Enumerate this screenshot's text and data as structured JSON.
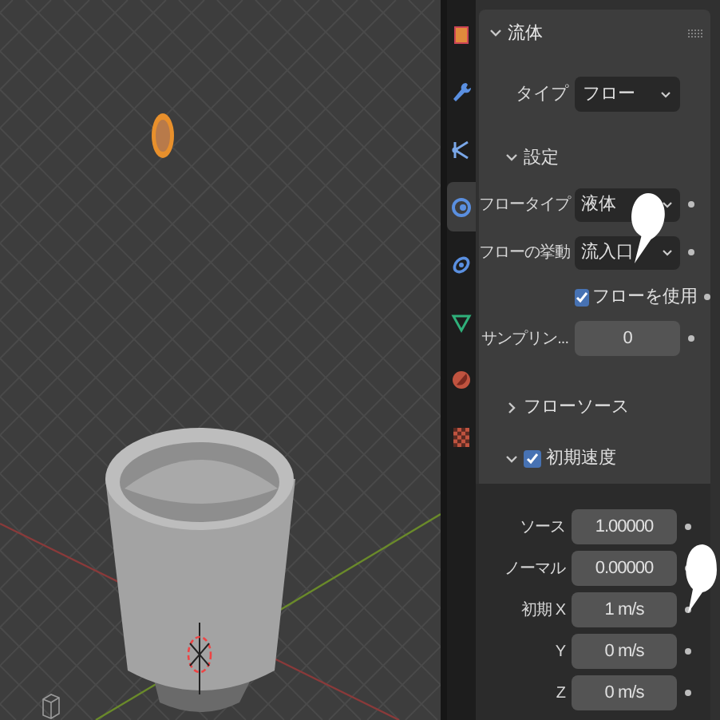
{
  "tabs": [
    {
      "kind": "object",
      "selected": false
    },
    {
      "kind": "modifier",
      "selected": false
    },
    {
      "kind": "particles",
      "selected": false
    },
    {
      "kind": "physics",
      "selected": true
    },
    {
      "kind": "constraints",
      "selected": false
    },
    {
      "kind": "data",
      "selected": false
    },
    {
      "kind": "material",
      "selected": false
    },
    {
      "kind": "texture",
      "selected": false
    }
  ],
  "panel": {
    "title": "流体",
    "expanded": true,
    "type_field": {
      "label": "タイプ",
      "value": "フロー"
    },
    "settings": {
      "title": "設定",
      "expanded": true,
      "rows": [
        {
          "kind": "dropdown",
          "label": "フロータイプ",
          "value": "液体"
        },
        {
          "kind": "dropdown",
          "label": "フローの挙動",
          "value": "流入口"
        },
        {
          "kind": "checkbox",
          "label": "フローを使用",
          "checked": true
        },
        {
          "kind": "number",
          "label": "サンプリン...",
          "value": "0"
        }
      ]
    },
    "subpanels": [
      {
        "title": "フローソース",
        "expanded": false
      },
      {
        "title": "初期速度",
        "expanded": true,
        "checked": true,
        "rows": [
          {
            "kind": "number",
            "label": "ソース",
            "value": "1.00000"
          },
          {
            "kind": "number",
            "label": "ノーマル",
            "value": "0.00000"
          },
          {
            "kind": "number",
            "label": "初期 X",
            "value": "1 m/s"
          },
          {
            "kind": "number",
            "label": "Y",
            "value": "0 m/s"
          },
          {
            "kind": "number",
            "label": "Z",
            "value": "0 m/s"
          }
        ]
      }
    ]
  }
}
